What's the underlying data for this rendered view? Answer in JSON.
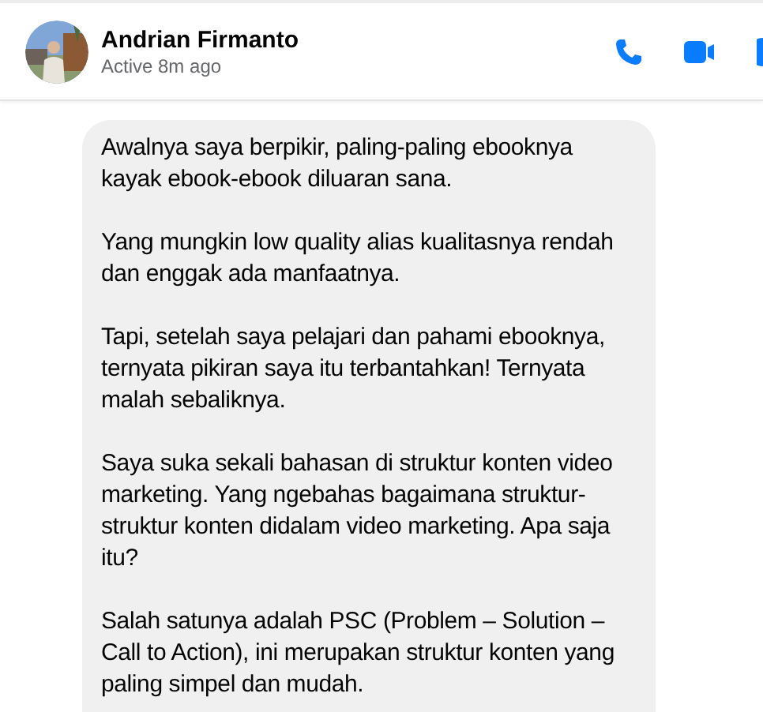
{
  "header": {
    "name": "Andrian Firmanto",
    "status": "Active 8m ago"
  },
  "message": {
    "paragraphs": [
      [
        "Awalnya saya berpikir, paling-paling ebooknya",
        "kayak ebook-ebook diluaran sana."
      ],
      [
        "Yang mungkin low quality alias kualitasnya rendah",
        "dan enggak ada manfaatnya."
      ],
      [
        "Tapi, setelah saya pelajari dan pahami ebooknya,",
        "ternyata pikiran saya itu terbantahkan! Ternyata",
        "malah sebaliknya."
      ],
      [
        "Saya suka sekali bahasan di struktur konten video",
        "marketing. Yang ngebahas bagaimana struktur-",
        "struktur konten didalam video marketing. Apa saja",
        "itu?"
      ],
      [
        "Salah satunya adalah PSC (Problem – Solution –",
        "Call to Action), ini merupakan struktur konten yang",
        "paling simpel dan mudah."
      ]
    ]
  }
}
